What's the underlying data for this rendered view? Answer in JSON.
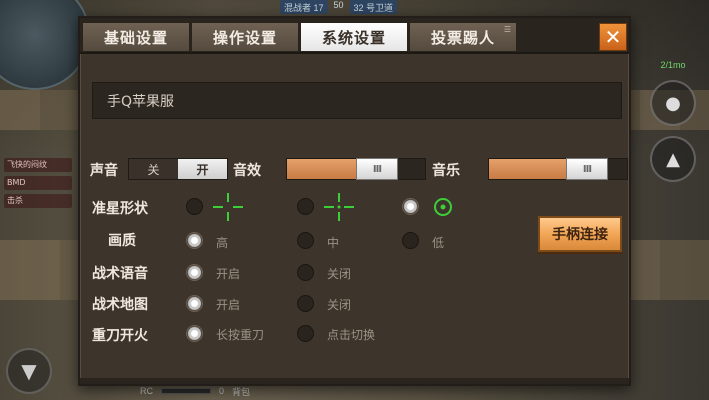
{
  "hud": {
    "top_left_text": "混战者 17",
    "score": "50",
    "badge": "32 号卫道",
    "side_log": [
      "飞快的闷纹",
      "BMD",
      "击杀"
    ],
    "green_value": "2/1mo",
    "bottom_label": "RC",
    "bottom_value": "0",
    "bottom_tag": "背包"
  },
  "tabs": [
    {
      "label": "基础设置",
      "active": false
    },
    {
      "label": "操作设置",
      "active": false
    },
    {
      "label": "系统设置",
      "active": true
    },
    {
      "label": "投票踢人",
      "active": false
    }
  ],
  "close_label": "✕",
  "server_name": "手Q苹果服",
  "sound": {
    "label": "声音",
    "off_label": "关",
    "on_label": "开",
    "value": "on"
  },
  "sfx": {
    "label": "音效",
    "level": 0.72,
    "thumb": "III"
  },
  "music": {
    "label": "音乐",
    "level": 0.8,
    "thumb": "III"
  },
  "crosshair": {
    "label": "准星形状",
    "options": [
      "cross-gap-a",
      "cross-gap-b",
      "circle-dot"
    ],
    "selected": 2,
    "color": "#3ccf3a"
  },
  "quality": {
    "label": "画质",
    "options": [
      "高",
      "中",
      "低"
    ],
    "selected": 0
  },
  "voice": {
    "label": "战术语音",
    "options": [
      "开启",
      "关闭"
    ],
    "selected": 0
  },
  "map": {
    "label": "战术地图",
    "options": [
      "开启",
      "关闭"
    ],
    "selected": 0
  },
  "melee": {
    "label": "重刀开火",
    "options": [
      "长按重刀",
      "点击切换"
    ],
    "selected": 0
  },
  "gamepad_button": "手柄连接",
  "colors": {
    "accent_orange": "#f0a352",
    "panel_bg": "#3d342b",
    "crosshair_green": "#3ccf3a"
  }
}
